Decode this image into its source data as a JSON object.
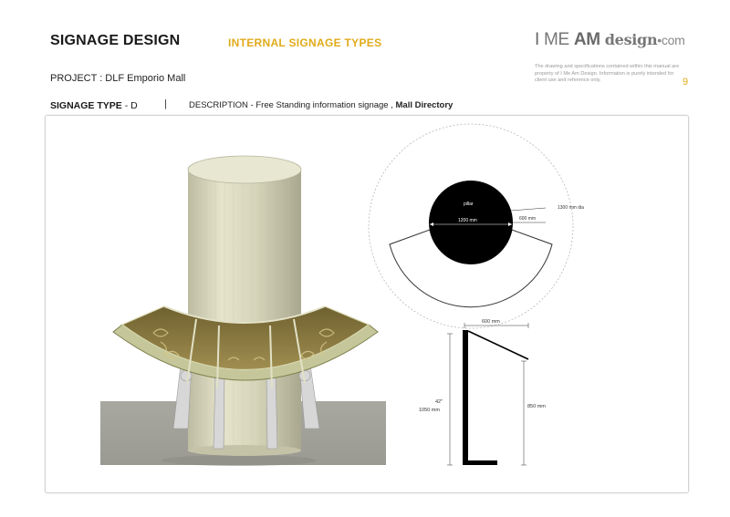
{
  "header": {
    "title": "SIGNAGE DESIGN",
    "section": "INTERNAL SIGNAGE TYPES",
    "project": "PROJECT : DLF Emporio Mall",
    "page_number": "9",
    "disclaimer": "The drawing and specifications contained within this manual are property of I Me Am Design. Information is purely intended for client use and reference only."
  },
  "logo": {
    "bar": "I",
    "me": "ME",
    "am": "AM",
    "design": "design",
    "dot": "•",
    "com": "com"
  },
  "signage": {
    "type_label": "SIGNAGE TYPE",
    "type_code": "- D",
    "separator": "|",
    "description_prefix": "DESCRIPTION - Free Standing information signage ,",
    "description_bold": "Mall Directory"
  },
  "plan_view": {
    "pillar_label": "pillar",
    "pillar_diameter": "1200 mm",
    "outer_diameter": "1300 mm dia",
    "ring_width": "600 mm"
  },
  "elevation_view": {
    "top_width": "600 mm",
    "height_inches": "42\"",
    "height_mm": "1050 mm",
    "front_height": "850 mm"
  },
  "colors": {
    "accent": "#e0ab1a",
    "pillar": "#d9d8be",
    "sign_panel": "#8a7a40",
    "floor": "#a0a098"
  }
}
